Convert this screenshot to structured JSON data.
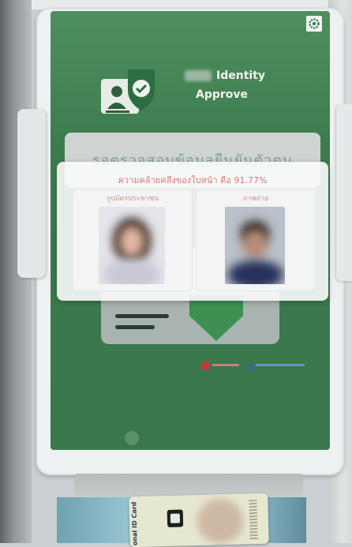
{
  "app": {
    "brand_line1": "Identity",
    "brand_line2": "Approve",
    "banner_text": "รอตรวจสอบข้อมูลยืนยันตัวตน"
  },
  "modal": {
    "title": "ความคล้ายคลึงของใบหน้า คือ 91.77%",
    "similarity_percent": 91.77,
    "left_label": "รูปบัตรประชาชน",
    "right_label": "ภาพถ่าย"
  },
  "card": {
    "text": "onal ID Card"
  },
  "icons": {
    "settings": "gear-icon",
    "logo": "id-card-shield-icon"
  },
  "colors": {
    "screen_green": "#3d7c4e",
    "title_red": "#d97a7a"
  }
}
